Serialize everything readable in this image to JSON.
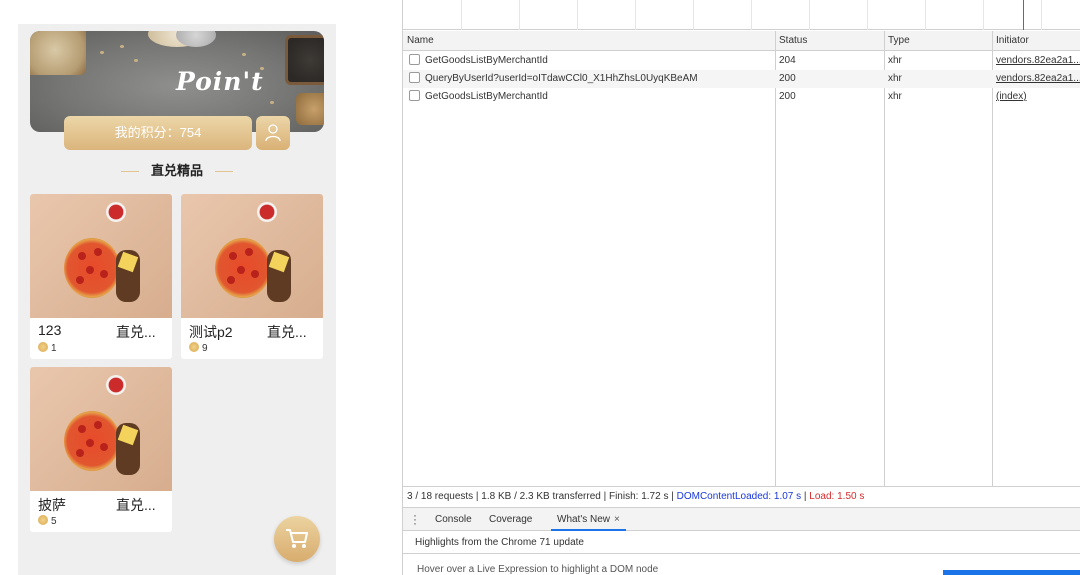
{
  "mobile": {
    "banner": {
      "brand": "Poin't"
    },
    "points_label": "我的积分：754",
    "section_title": "直兑精品",
    "products": [
      {
        "title": "123",
        "subtitle": "直兑...",
        "price": "1"
      },
      {
        "title": "测试p2",
        "subtitle": "直兑...",
        "price": "9"
      },
      {
        "title": "披萨",
        "subtitle": "直兑...",
        "price": "5"
      }
    ]
  },
  "devtools": {
    "columns": {
      "name": "Name",
      "status": "Status",
      "type": "Type",
      "initiator": "Initiator"
    },
    "requests": [
      {
        "name": "GetGoodsListByMerchantId",
        "status": "204",
        "type": "xhr",
        "initiator": "vendors.82ea2a1..."
      },
      {
        "name": "QueryByUserId?userId=oITdawCCl0_X1HhZhsL0UyqKBeAM",
        "status": "200",
        "type": "xhr",
        "initiator": "vendors.82ea2a1..."
      },
      {
        "name": "GetGoodsListByMerchantId",
        "status": "200",
        "type": "xhr",
        "initiator": "(index)"
      }
    ],
    "summary": {
      "main": "3 / 18 requests | 1.8 KB / 2.3 KB transferred | Finish: 1.72 s | ",
      "dcl": "DOMContentLoaded: 1.07 s",
      "sep": " | ",
      "load": "Load: 1.50 s"
    },
    "drawer_tabs": [
      "Console",
      "Coverage",
      "What's New"
    ],
    "close_glyph": "×",
    "whats_new_title": "Highlights from the Chrome 71 update",
    "peek_text": "Hover over a Live Expression to highlight a DOM node"
  },
  "colors": {
    "gold_light": "#ecd6a8",
    "gold_dark": "#dbb57c",
    "dcl_blue": "#1a37d9",
    "load_red": "#d62b2b",
    "tab_active": "#1a73e8"
  }
}
